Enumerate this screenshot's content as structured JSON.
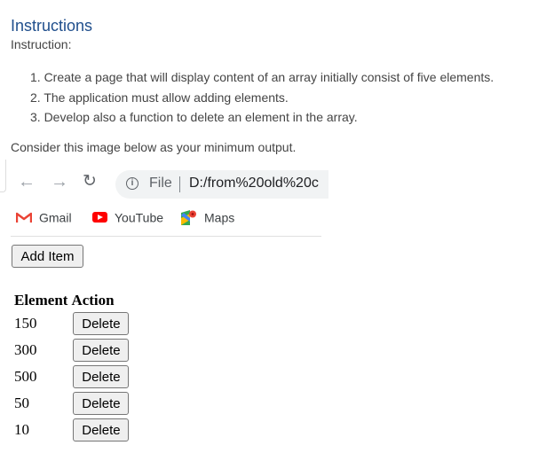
{
  "page": {
    "title": "Instructions",
    "label": "Instruction:",
    "steps": [
      "1. Create a page that will display content of an array initially consist of five elements.",
      "2. The application must allow adding elements.",
      "3. Develop also a function to delete an element in the array."
    ],
    "consider": "Consider this image below as your minimum output."
  },
  "screenshot": {
    "browser": {
      "icons": {
        "back": "arrow-left-icon",
        "forward": "arrow-right-icon",
        "reload": "reload-icon",
        "info": "info-icon"
      },
      "scheme": "File",
      "url": "D:/from%20old%20c",
      "bookmarks": [
        {
          "label": "Gmail",
          "icon": "gmail-icon"
        },
        {
          "label": "YouTube",
          "icon": "youtube-icon"
        },
        {
          "label": "Maps",
          "icon": "maps-icon"
        }
      ]
    },
    "app": {
      "add_button": "Add Item",
      "table": {
        "headers": [
          "Element",
          "Action"
        ],
        "rows": [
          {
            "element": "150",
            "action": "Delete"
          },
          {
            "element": "300",
            "action": "Delete"
          },
          {
            "element": "500",
            "action": "Delete"
          },
          {
            "element": "50",
            "action": "Delete"
          },
          {
            "element": "10",
            "action": "Delete"
          }
        ]
      }
    }
  },
  "colors": {
    "title": "#1f4e8c",
    "youtube": "#ff0000",
    "gmail": "#ea4335"
  }
}
